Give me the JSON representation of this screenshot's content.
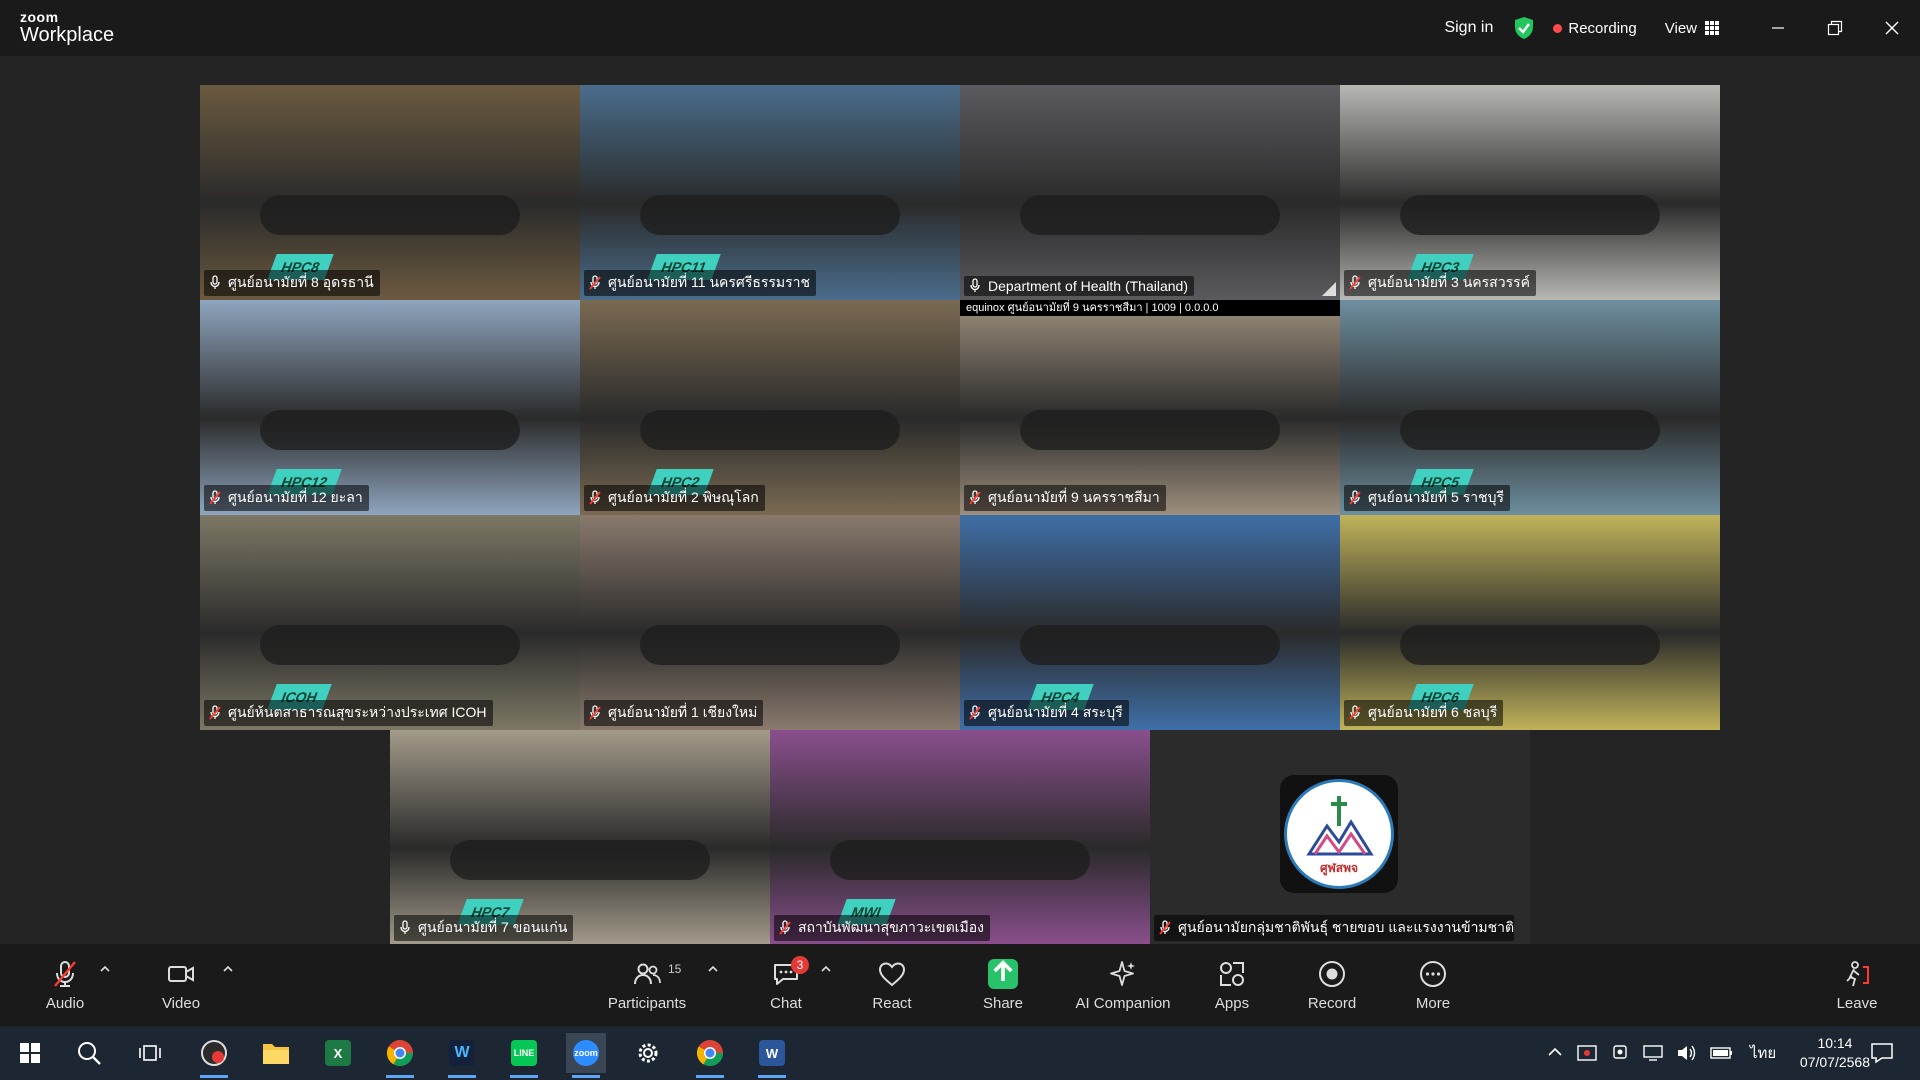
{
  "window": {
    "brand_top": "zoom",
    "brand_bottom": "Workplace",
    "sign_in": "Sign in",
    "recording": "Recording",
    "view": "View"
  },
  "gallery": {
    "tiles": [
      {
        "name": "ศูนย์อนามัยที่ 8 อุดรธานี",
        "banner": "HPC8",
        "muted": false,
        "active": false,
        "scene": "#6b5a40"
      },
      {
        "name": "ศูนย์อนามัยที่ 11 นครศรีธรรมราช",
        "banner": "HPC11",
        "muted": true,
        "active": false,
        "scene": "#4a6d8c"
      },
      {
        "name": "Department of Health (Thailand)",
        "banner": "",
        "muted": false,
        "active": true,
        "scene": "#5b5a5e"
      },
      {
        "name": "ศูนย์อนามัยที่ 3 นครสวรรค์",
        "banner": "HPC3",
        "muted": true,
        "active": false,
        "scene": "#b7b8b4"
      },
      {
        "name": "ศูนย์อนามัยที่ 12 ยะลา",
        "banner": "HPC12",
        "muted": true,
        "active": false,
        "scene": "#8fa5bf"
      },
      {
        "name": "ศูนย์อนามัยที่ 2 พิษณุโลก",
        "banner": "HPC2",
        "muted": true,
        "active": false,
        "scene": "#7a6a52"
      },
      {
        "name": "ศูนย์อนามัยที่ 9 นครราชสีมา",
        "banner": "",
        "muted": true,
        "active": false,
        "scene": "#9d8f7d"
      },
      {
        "name": "ศูนย์อนามัยที่ 5 ราชบุรี",
        "banner": "HPC5",
        "muted": true,
        "active": false,
        "scene": "#6e8fa0"
      },
      {
        "name": "ศูนย์ห้นตสาธารณสุขระหว่างประเทศ ICOH",
        "banner": "ICOH",
        "muted": true,
        "active": false,
        "scene": "#7d7865"
      },
      {
        "name": "ศูนย์อนามัยที่ 1 เชียงใหม่",
        "banner": "",
        "muted": true,
        "active": false,
        "scene": "#8a7a6d"
      },
      {
        "name": "ศูนย์อนามัยที่ 4 สระบุรี",
        "banner": "HPC4",
        "muted": true,
        "active": false,
        "scene": "#3f6fa8"
      },
      {
        "name": "ศูนย์อนามัยที่ 6 ชลบุรี",
        "banner": "HPC6",
        "muted": true,
        "active": false,
        "scene": "#c0b35a"
      },
      {
        "name": "ศูนย์อนามัยที่ 7 ขอนแก่น",
        "banner": "HPC7",
        "muted": false,
        "active": false,
        "scene": "#a39b8a"
      },
      {
        "name": "สถาบันพัฒนาสุขภาวะเขตเมือง",
        "banner": "MWI",
        "muted": true,
        "active": false,
        "scene": "#8a4f8e"
      },
      {
        "name": "ศูนย์อนามัยกลุ่มชาติพันธุ์ ชายขอบ และแรงงานข้ามชาติ",
        "banner": "",
        "muted": true,
        "active": false,
        "scene": "logo"
      }
    ],
    "tile3_overlay": "equinox  ศูนย์อนามัยที่ 9 นครราชสีมา | 1009 | 0.0.0.0",
    "logo_text": "ศูฬสพจ"
  },
  "toolbar": {
    "audio": "Audio",
    "video": "Video",
    "participants": "Participants",
    "participants_count": "15",
    "chat": "Chat",
    "chat_badge": "3",
    "react": "React",
    "share": "Share",
    "ai_companion": "AI Companion",
    "apps": "Apps",
    "record": "Record",
    "more": "More",
    "leave": "Leave"
  },
  "taskbar": {
    "language": "ไทย",
    "time": "10:14",
    "date": "07/07/2568"
  },
  "colors": {
    "accent_green": "#3ddc84",
    "record_red": "#ff4b4b",
    "share_green": "#27c26a",
    "muted_red": "#ff3b30"
  }
}
